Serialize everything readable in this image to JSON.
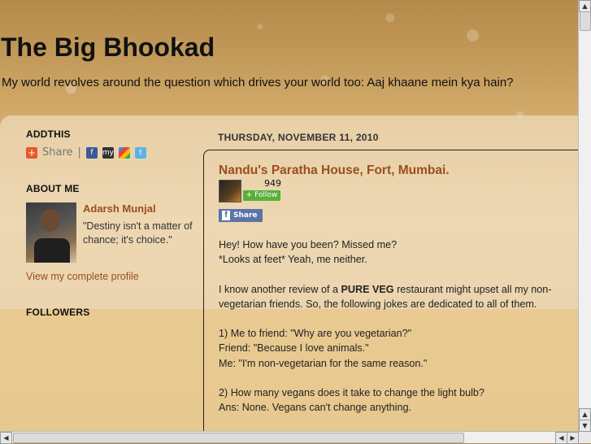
{
  "header": {
    "title": "The Big Bhookad",
    "description": "My world revolves around the question which drives your world too: Aaj khaane mein kya hain?"
  },
  "sidebar": {
    "addthis": {
      "title": "ADDTHIS",
      "share_label": "Share",
      "separator": "|",
      "icons": [
        "facebook-icon",
        "myspace-icon",
        "google-icon",
        "twitter-icon"
      ]
    },
    "about": {
      "title": "ABOUT ME",
      "name": "Adarsh Munjal",
      "quote": "\"Destiny isn't a matter of chance; it's choice.\"",
      "profile_link": "View my complete profile"
    },
    "followers": {
      "title": "FOLLOWERS"
    }
  },
  "post": {
    "date": "THURSDAY, NOVEMBER 11, 2010",
    "title": "Nandu's Paratha House, Fort, Mumbai.",
    "follow_count": "949",
    "follow_label": "+ Follow",
    "fb_share_label": "Share",
    "fb_icon_label": "f",
    "body": {
      "p1a": "Hey! How have you been? Missed me?",
      "p1b": "*Looks at feet* Yeah, me neither.",
      "p2_before": "I know another review of a ",
      "p2_bold": "PURE VEG",
      "p2_after": " restaurant might upset all my non-vegetarian friends. So, the following jokes are dedicated to all of them.",
      "j1a": "1) Me to friend: \"Why are you vegetarian?\"",
      "j1b": "Friend: \"Because I love animals.\"",
      "j1c": "Me: \"I'm non-vegetarian for the same reason.\"",
      "j2a": "2) How many vegans does it take to change the light bulb?",
      "j2b": "Ans: None. Vegans can't change anything."
    }
  },
  "scrollbars": {
    "up_arrow": "▲",
    "down_arrow": "▼",
    "left_arrow": "◀",
    "right_arrow": "▶"
  },
  "colors": {
    "link": "#9a4f1c",
    "follow_green": "#58b03a",
    "facebook_blue": "#5b74a8"
  }
}
